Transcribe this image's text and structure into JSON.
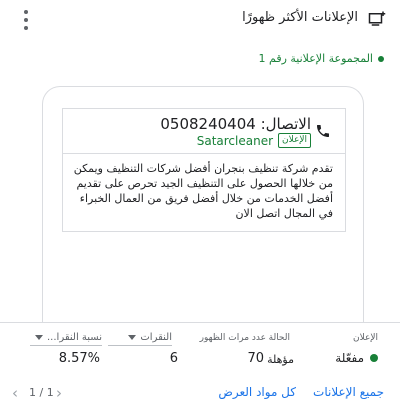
{
  "header": {
    "title": "الإعلانات الأكثر ظهورًا",
    "menu_icon": "more-vert-icon",
    "add_icon": "add-to-queue-icon"
  },
  "group": {
    "label": "المجموعة الإعلانية رقم 1",
    "status_color": "#188038"
  },
  "ad": {
    "headline": "الاتصال: 0508240404",
    "badge": "الإعلان",
    "display_name": "Satarcleaner",
    "description": "تقدم شركة تنظيف بنجران أفضل شركات التنظيف ويمكن من خلالها الحصول على التنظيف الجيد تحرص على تقديم أفضل الخدمات من خلال أفضل فريق من العمال الخبراء في المجال اتصل الان",
    "icon": "phone-icon"
  },
  "stats": {
    "ad_label": "الإعلان",
    "ad_status": "مفعّلة",
    "state_label": "الحالة",
    "state_value": "مؤهلة",
    "impressions_label": "عدد مرات الظهور",
    "impressions_value": "70",
    "clicks_label": "النقرات",
    "clicks_value": "6",
    "ctr_label": "نسبة النقرا...",
    "ctr_value": "8.57%"
  },
  "footer": {
    "pagination": "1 / 1",
    "all_ads_link": "جميع الإعلانات",
    "all_assets_link": "كل مواد العرض"
  },
  "colors": {
    "accent": "#1a73e8",
    "success": "#188038",
    "border": "#dadce0"
  }
}
